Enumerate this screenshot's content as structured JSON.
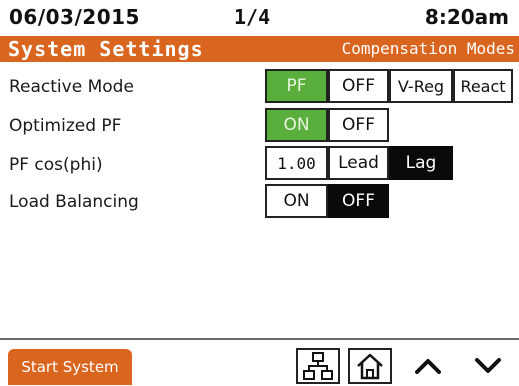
{
  "status": {
    "date": "06/03/2015",
    "page": "1/4",
    "time": "8:20am"
  },
  "title": {
    "left": "System Settings",
    "right": "Compensation Modes"
  },
  "rows": {
    "reactive_mode": {
      "label": "Reactive Mode",
      "options": [
        "PF",
        "OFF",
        "V-Reg",
        "React"
      ],
      "selected": "PF"
    },
    "optimized_pf": {
      "label": "Optimized PF",
      "options": [
        "ON",
        "OFF"
      ],
      "selected": "ON"
    },
    "pf_cos_phi": {
      "label": "PF cos(phi)",
      "value": "1.00",
      "options": [
        "Lead",
        "Lag"
      ],
      "selected": "Lag"
    },
    "load_balancing": {
      "label": "Load Balancing",
      "options": [
        "ON",
        "OFF"
      ],
      "selected": "OFF"
    }
  },
  "footer": {
    "start_label": "Start System",
    "icons": [
      "network-icon",
      "home-icon",
      "chevron-up-icon",
      "chevron-down-icon"
    ]
  },
  "colors": {
    "accent": "#d9651f",
    "selected_green": "#5aae3c",
    "selected_black": "#0a0a0a"
  }
}
